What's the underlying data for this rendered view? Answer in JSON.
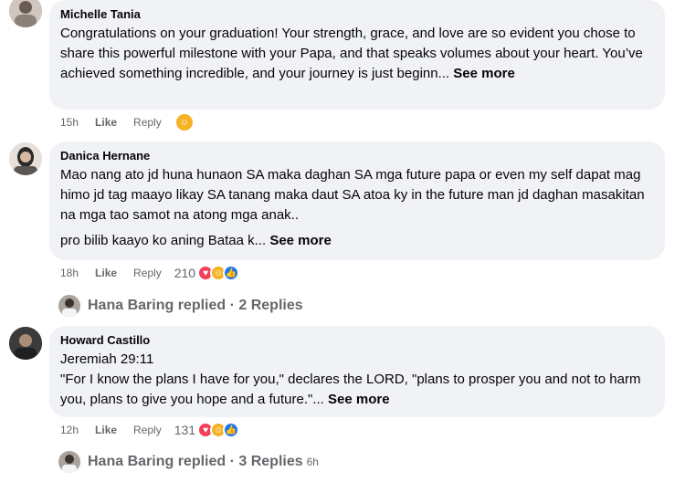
{
  "comments": [
    {
      "name": "Michelle Tania",
      "paragraphs": [
        "Congratulations on your graduation! Your strength, grace, and love are so evident you chose to share this powerful milestone with your Papa, and that speaks volumes about your heart. You’ve achieved something incredible, and your journey is just beginn..."
      ],
      "see_more": "See more",
      "time": "15h",
      "like": "Like",
      "reply": "Reply",
      "reaction_count": ""
    },
    {
      "name": "Danica Hernane",
      "paragraphs": [
        "Mao nang ato jd huna hunaon SA maka daghan SA mga future papa or even my self dapat mag himo jd tag maayo likay SA tanang maka daut SA atoa ky in the future man jd daghan masakitan na mga tao samot na atong mga anak..",
        "pro bilib kaayo ko aning Bataa k..."
      ],
      "see_more": "See more",
      "time": "18h",
      "like": "Like",
      "reply": "Reply",
      "reaction_count": "210"
    },
    {
      "name": "Howard Castillo",
      "paragraphs": [
        "Jeremiah 29:11",
        "\"For I know the plans I have for you,\" declares the LORD, \"plans to prosper you and not to harm you, plans to give you hope and a future.\"..."
      ],
      "see_more": "See more",
      "time": "12h",
      "like": "Like",
      "reply": "Reply",
      "reaction_count": "131"
    }
  ],
  "reply_threads": [
    {
      "text": "Hana Baring replied · 2 Replies",
      "time": ""
    },
    {
      "text": "Hana Baring replied · 3 Replies",
      "time": "6h"
    }
  ],
  "colors": {
    "bubble": "#f0f2f5",
    "meta_text": "#65676b",
    "heart": "#f33e58",
    "care": "#f7b125",
    "like": "#1877f2"
  }
}
